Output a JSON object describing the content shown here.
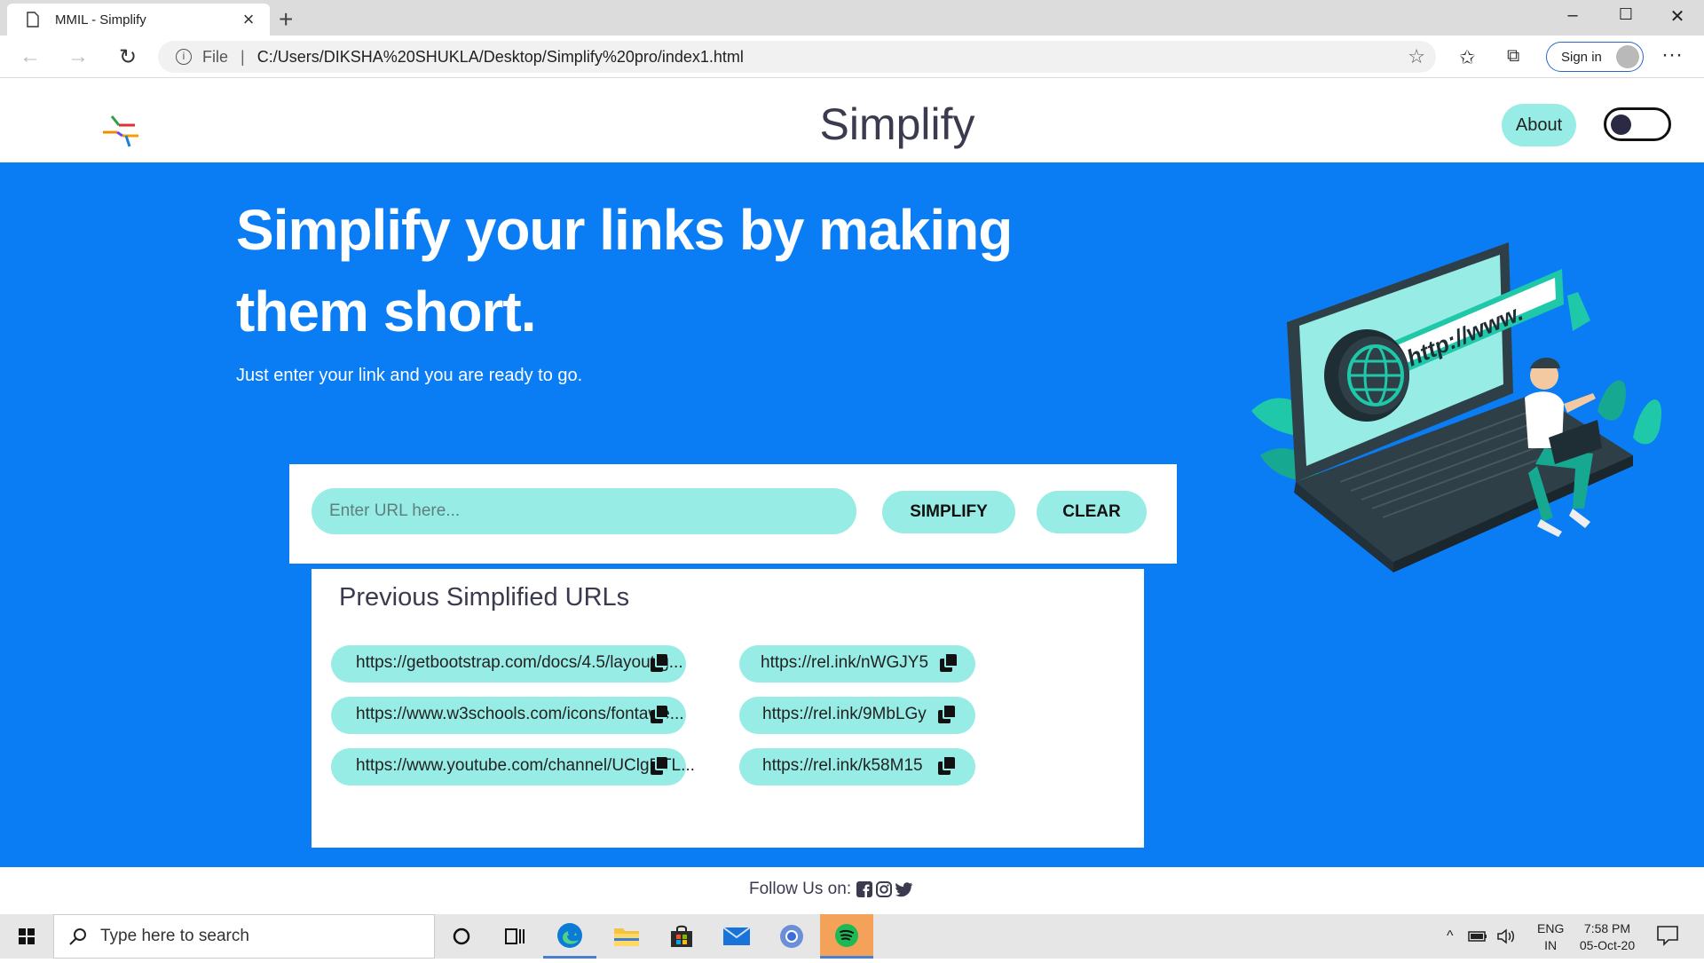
{
  "browser": {
    "tab_title": "MMIL - Simplify",
    "tab_close": "×",
    "new_tab": "+",
    "url_file_label": "File",
    "url_separator": "|",
    "url": "C:/Users/DIKSHA%20SHUKLA/Desktop/Simplify%20pro/index1.html",
    "signin_label": "Sign in",
    "minimize": "–",
    "maximize": "☐",
    "close": "✕",
    "more": "···"
  },
  "header": {
    "title": "Simplify",
    "about_label": "About"
  },
  "hero": {
    "heading": "Simplify your links by making them short.",
    "subtitle": "Just enter your link and you are ready to go."
  },
  "form": {
    "input_placeholder": "Enter URL here...",
    "input_value": "",
    "simplify_label": "SIMPLIFY",
    "clear_label": "CLEAR"
  },
  "history": {
    "title": "Previous Simplified URLs",
    "items": [
      {
        "original": "https://getbootstrap.com/docs/4.5/layout/g...",
        "short": "https://rel.ink/nWGJY5"
      },
      {
        "original": "https://www.w3schools.com/icons/fontawe...",
        "short": "https://rel.ink/9MbLGy"
      },
      {
        "original": "https://www.youtube.com/channel/UClgRTL...",
        "short": "https://rel.ink/k58M15"
      }
    ]
  },
  "illustration": {
    "screen_text": "http://www."
  },
  "footer": {
    "follow_label": "Follow Us on:",
    "social_icons": [
      "facebook-icon",
      "instagram-icon",
      "twitter-icon"
    ]
  },
  "taskbar": {
    "search_placeholder": "Type here to search",
    "language": "ENG",
    "region": "IN",
    "time": "7:58 PM",
    "date": "05-Oct-20"
  },
  "colors": {
    "brand_blue": "#0a7df5",
    "accent_teal": "#97ede5",
    "text_dark": "#3b3b4f"
  }
}
